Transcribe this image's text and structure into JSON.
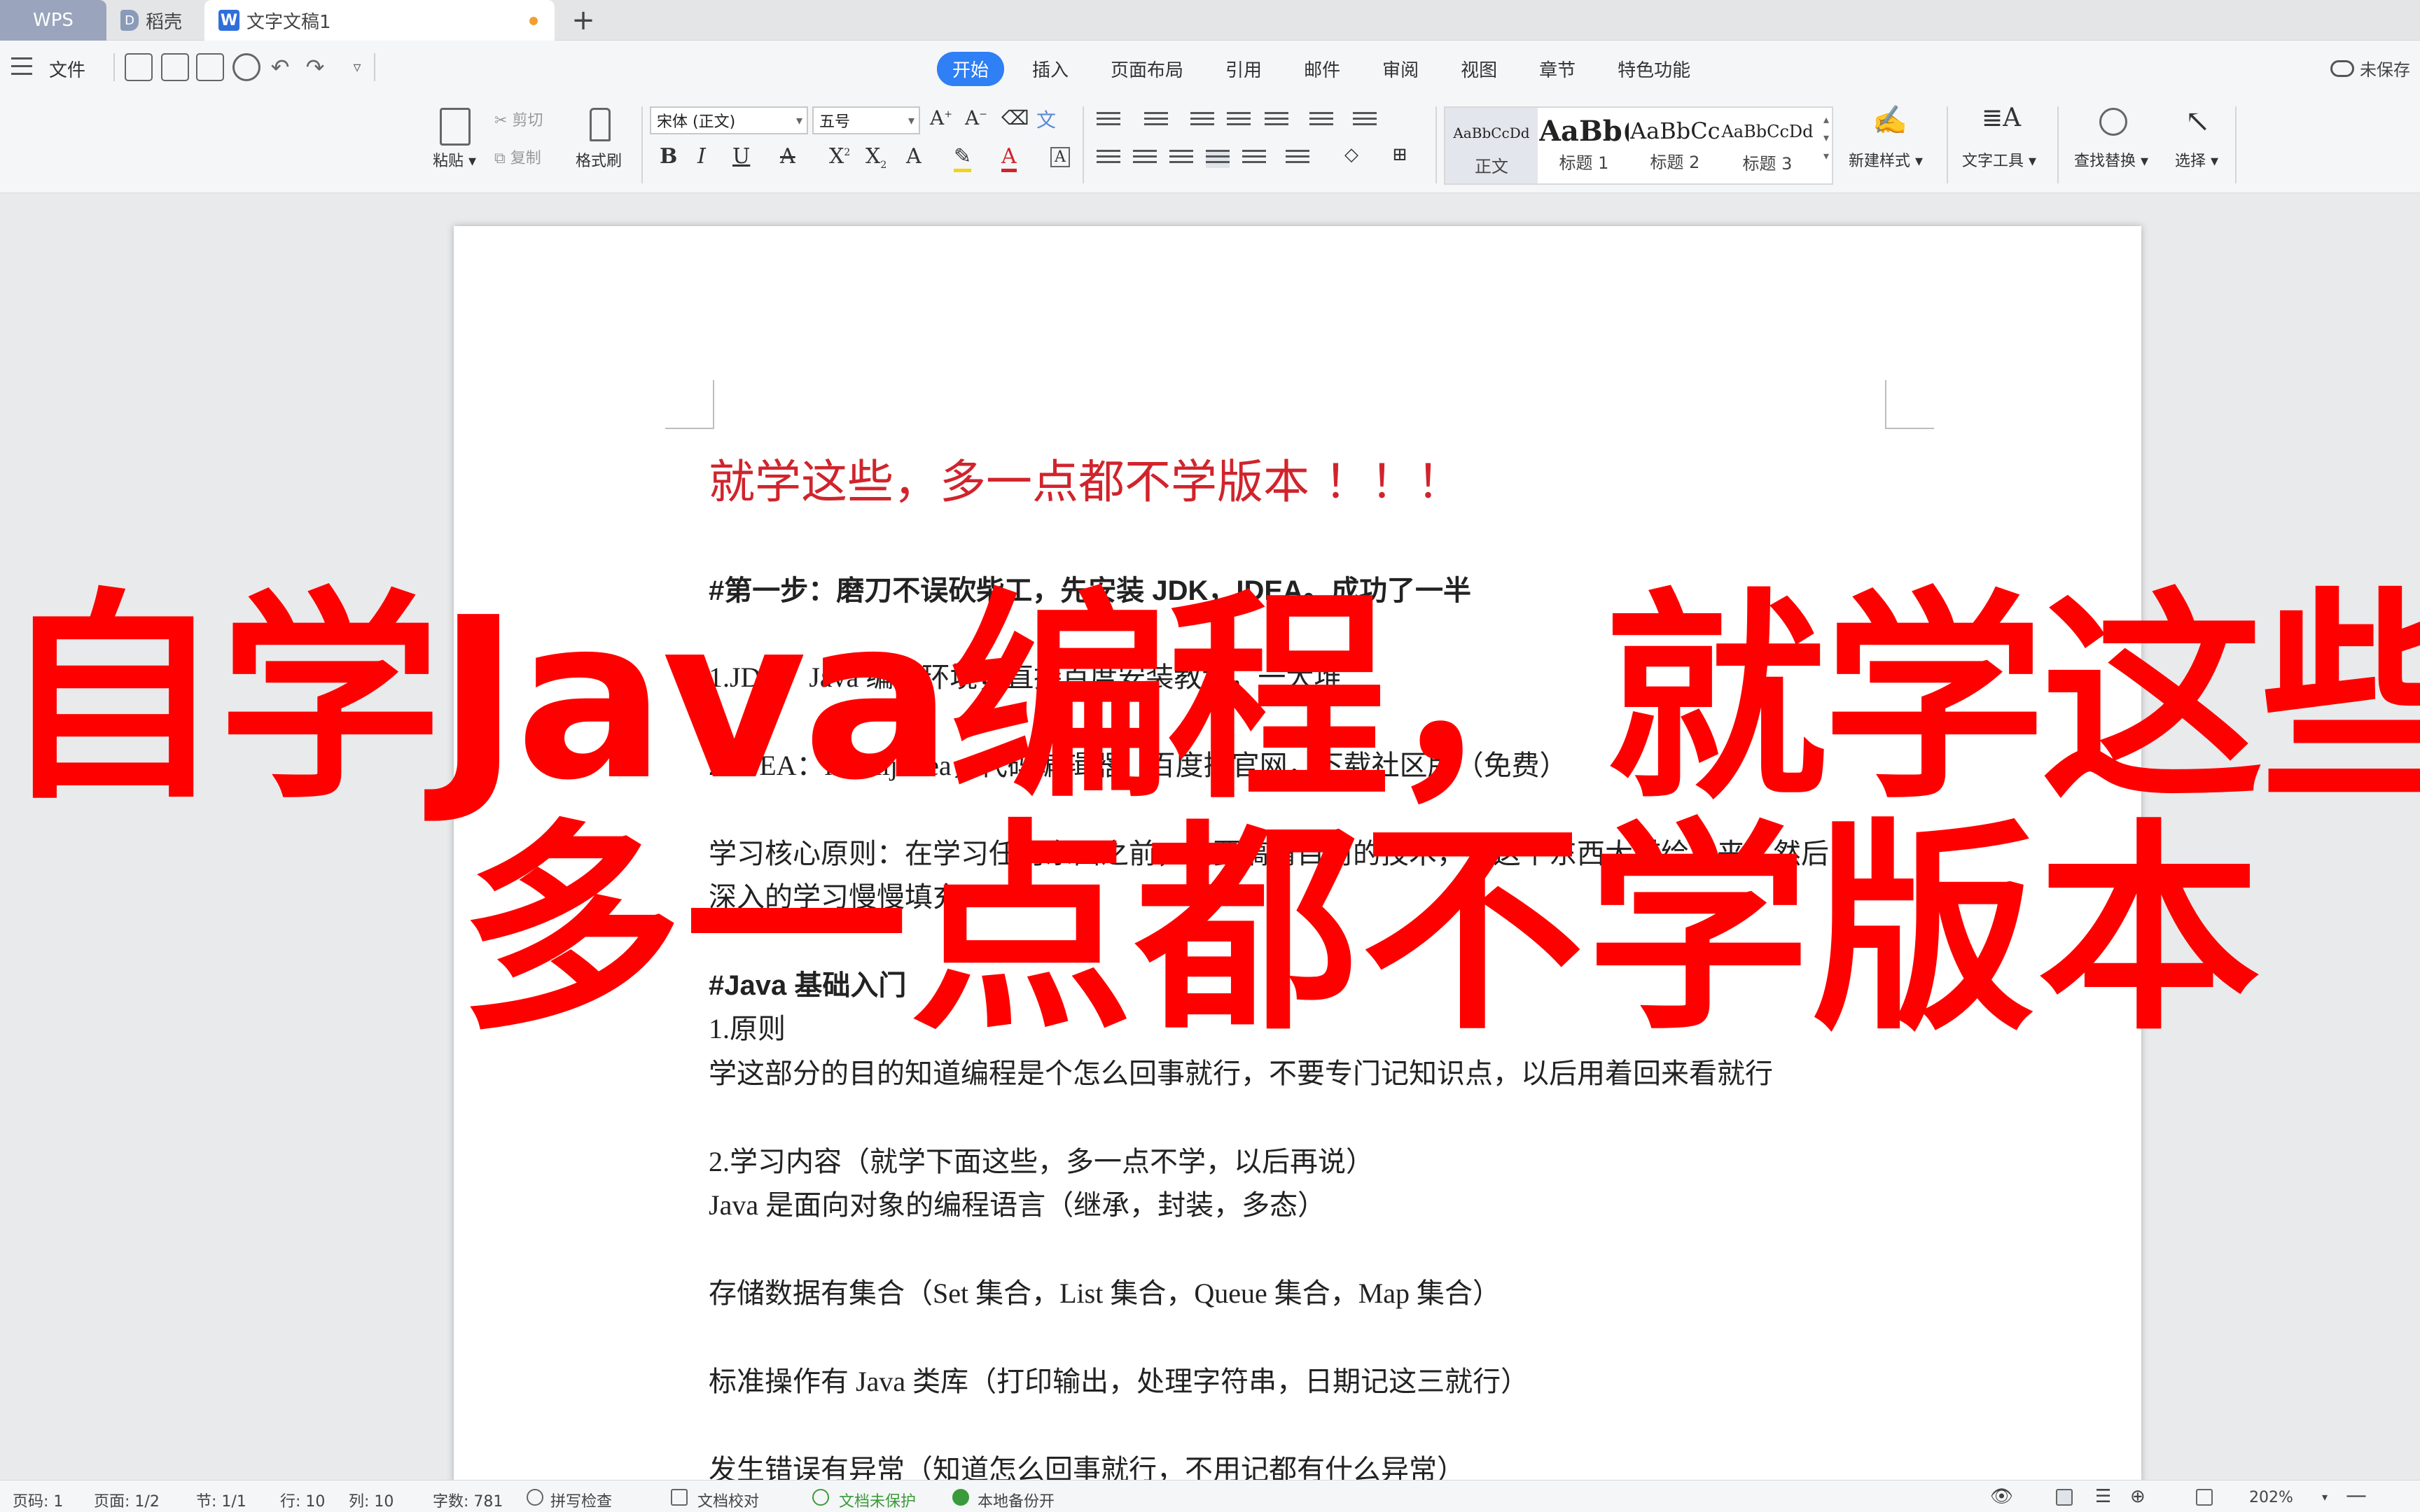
{
  "tabs": {
    "wps": "WPS",
    "daoke": "稻壳",
    "doc": "文字文稿1",
    "new_tab": "+"
  },
  "menubar": {
    "file": "文件",
    "items": [
      "开始",
      "插入",
      "页面布局",
      "引用",
      "邮件",
      "审阅",
      "视图",
      "章节",
      "特色功能"
    ],
    "unsaved": "未保存"
  },
  "ribbon": {
    "paste": "粘贴",
    "cut": "剪切",
    "copy": "复制",
    "format_painter": "格式刷",
    "font_name": "宋体 (正文)",
    "font_size": "五号",
    "styles": [
      {
        "preview": "AaBbCcDd",
        "name": "正文"
      },
      {
        "preview": "AaBb(",
        "name": "标题 1"
      },
      {
        "preview": "AaBbCc(",
        "name": "标题 2"
      },
      {
        "preview": "AaBbCcDd",
        "name": "标题 3"
      }
    ],
    "new_style": "新建样式",
    "text_tools": "文字工具",
    "find_replace": "查找替换",
    "select": "选择"
  },
  "document": {
    "title": "就学这些，多一点都不学版本  ！！！",
    "lines": [
      "#第一步：磨刀不误砍柴工，先安装 JDK，IDEA。成功了一半",
      "1.JDK：Java 编程环境，直接百度安装教程，一大堆",
      "2.IDEA：intellij idea，代码编辑器，百度搜官网，下载社区版（免费）",
      "学习核心原则：在学习任何东西之前，先要搞清目前的技术，把这个东西大描绘出来，然后",
      "深入的学习慢慢填充",
      "#Java 基础入门",
      "1.原则",
      "学这部分的目的知道编程是个怎么回事就行，不要专门记知识点，以后用着回来看就行",
      "2.学习内容（就学下面这些，多一点不学，以后再说）",
      "Java 是面向对象的编程语言（继承，封装，多态）",
      "存储数据有集合（Set 集合，List 集合，Queue 集合，Map 集合）",
      "标准操作有 Java 类库（打印输出，处理字符串，日期记这三就行）",
      "发生错误有异常（知道怎么回事就行，不用记都有什么异常）"
    ]
  },
  "overlay": {
    "line1": "自学Java编程，就学这些",
    "line2": "多一点都不学版本"
  },
  "status": {
    "page_no": "页码: 1",
    "pages": "页面: 1/2",
    "section": "节: 1/1",
    "row": "行: 10",
    "col": "列: 10",
    "words": "字数: 781",
    "spell_check": "拼写检查",
    "proofread": "文档校对",
    "unprotected": "文档未保护",
    "backup": "本地备份开",
    "zoom": "202%"
  },
  "colors": {
    "accent": "#2f7ff5",
    "overlay_red": "#ff0000",
    "title_red": "#d0242c"
  }
}
